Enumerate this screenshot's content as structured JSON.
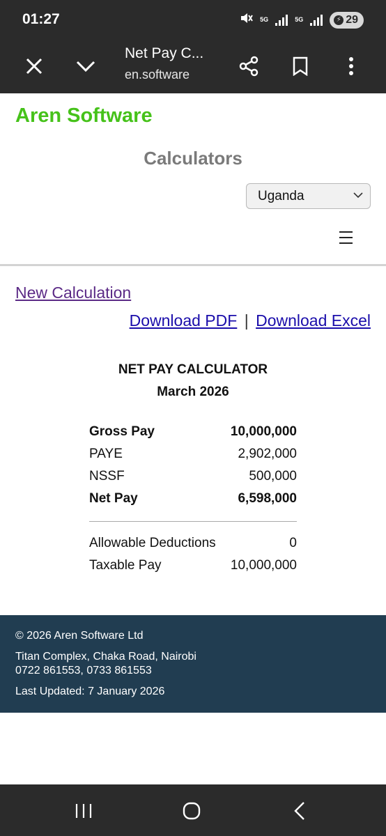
{
  "status_bar": {
    "time": "01:27",
    "network_1": "5G",
    "network_2": "5G",
    "battery": "29",
    "icons": [
      "mute-icon",
      "signal-icon",
      "signal-icon",
      "battery-saver-icon"
    ]
  },
  "browser": {
    "title": "Net Pay C...",
    "url": "en.software",
    "icons": [
      "close-icon",
      "chevron-down-icon",
      "share-icon",
      "bookmark-icon",
      "more-vert-icon"
    ]
  },
  "site": {
    "brand": "Aren Software",
    "brand_color": "#46c21a",
    "calculators_title": "Calculators",
    "country_selected": "Uganda",
    "menu_icon": "hamburger-icon"
  },
  "actions": {
    "new_calculation": "New Calculation",
    "download_pdf": "Download PDF",
    "separator": "|",
    "download_excel": "Download Excel"
  },
  "report": {
    "title": "NET PAY CALCULATOR",
    "period": "March 2026",
    "summary": [
      {
        "label": "Gross Pay",
        "value": "10,000,000",
        "bold": true
      },
      {
        "label": "PAYE",
        "value": "2,902,000",
        "bold": false
      },
      {
        "label": "NSSF",
        "value": "500,000",
        "bold": false
      },
      {
        "label": "Net Pay",
        "value": "6,598,000",
        "bold": true
      }
    ],
    "details": [
      {
        "label": "Allowable Deductions",
        "value": "0"
      },
      {
        "label": "Taxable Pay",
        "value": "10,000,000"
      }
    ]
  },
  "footer": {
    "copyright": "© 2026 Aren Software Ltd",
    "address": "Titan Complex, Chaka Road, Nairobi",
    "phones": "0722 861553, 0733 861553",
    "updated": "Last Updated: 7 January 2026",
    "bg_color": "#213d51"
  },
  "nav": {
    "icons": [
      "recent-apps-icon",
      "home-icon",
      "back-icon"
    ]
  }
}
